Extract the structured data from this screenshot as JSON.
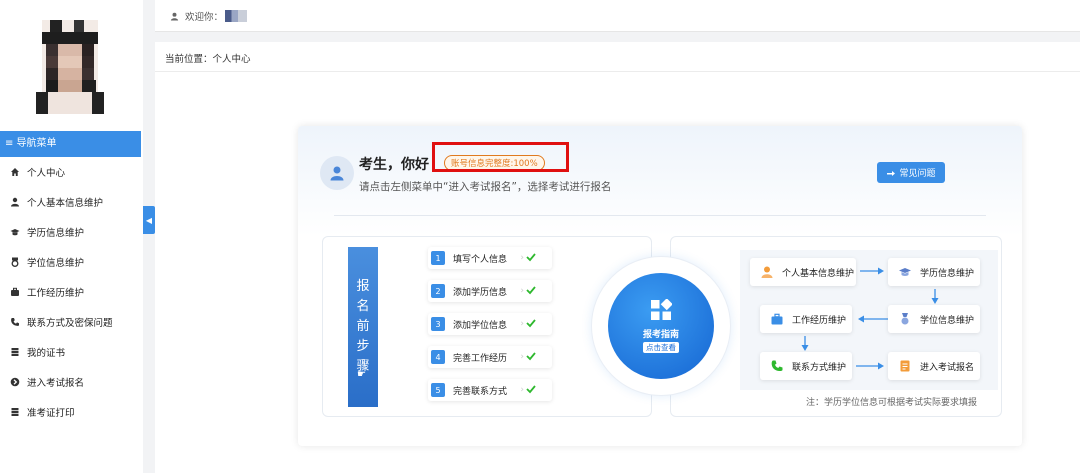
{
  "topbar": {
    "welcome_label": "欢迎你："
  },
  "breadcrumb": {
    "text": "当前位置：个人中心"
  },
  "sidebar": {
    "header": "≡ 导航菜单",
    "items": [
      {
        "label": "个人中心",
        "icon": "home-icon"
      },
      {
        "label": "个人基本信息维护",
        "icon": "user-icon"
      },
      {
        "label": "学历信息维护",
        "icon": "graduation-cap-icon"
      },
      {
        "label": "学位信息维护",
        "icon": "medal-icon"
      },
      {
        "label": "工作经历维护",
        "icon": "briefcase-icon"
      },
      {
        "label": "联系方式及密保问题",
        "icon": "phone-icon"
      },
      {
        "label": "我的证书",
        "icon": "certificate-icon"
      },
      {
        "label": "进入考试报名",
        "icon": "arrow-circle-icon"
      },
      {
        "label": "准考证打印",
        "icon": "print-icon"
      }
    ],
    "collapse_glyph": "◀"
  },
  "greeting": {
    "title": "考生，你好",
    "completeness": "账号信息完整度:100%",
    "subtitle": "请点击左侧菜单中“进入考试报名”，选择考试进行报名",
    "faq_button": "常见问题"
  },
  "steps": {
    "banner_text": "报名前步骤",
    "items": [
      {
        "num": "1",
        "label": "填写个人信息"
      },
      {
        "num": "2",
        "label": "添加学历信息"
      },
      {
        "num": "3",
        "label": "添加学位信息"
      },
      {
        "num": "4",
        "label": "完善工作经历"
      },
      {
        "num": "5",
        "label": "完善联系方式"
      }
    ]
  },
  "guide": {
    "title": "报考指南",
    "action": "点击查看"
  },
  "flow": {
    "nodes": [
      {
        "label": "个人基本信息维护",
        "icon": "person-orange-icon"
      },
      {
        "label": "学历信息维护",
        "icon": "graduation-cap-icon"
      },
      {
        "label": "工作经历维护",
        "icon": "briefcase-icon"
      },
      {
        "label": "学位信息维护",
        "icon": "medal-icon"
      },
      {
        "label": "联系方式维护",
        "icon": "phone-green-icon"
      },
      {
        "label": "进入考试报名",
        "icon": "form-orange-icon"
      }
    ],
    "note": "注：学历学位信息可根据考试实际要求填报"
  },
  "colors": {
    "primary": "#3a8ee6",
    "highlight_red": "#e01010",
    "badge_orange": "#e07a1f",
    "check_green": "#2eb82e"
  }
}
